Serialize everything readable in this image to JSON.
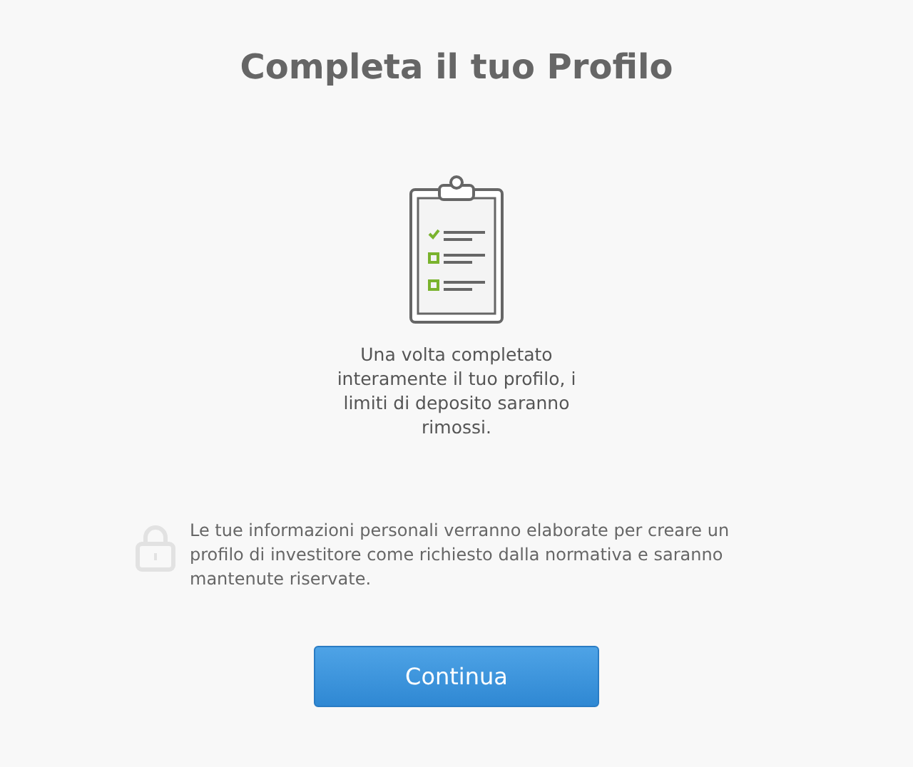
{
  "title": "Completa il tuo Profilo",
  "description": "Una volta completato interamente il tuo profilo, i limiti di deposito saranno rimossi.",
  "privacy_notice": "Le tue informazioni personali verranno elaborate per creare un profilo di investitore come richiesto dalla normativa e saranno mantenute riservate.",
  "button": "Continua"
}
